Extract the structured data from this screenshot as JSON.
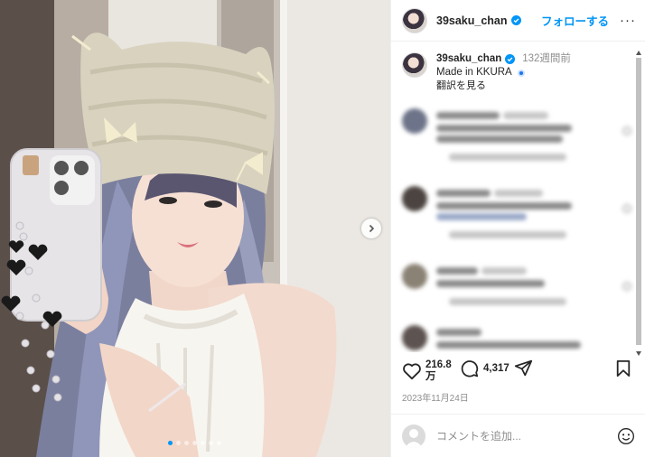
{
  "post": {
    "username": "39saku_chan",
    "follow_label": "フォローする",
    "more_label": "···",
    "caption": {
      "username": "39saku_chan",
      "time_ago": "132週間前",
      "text": "Made in KKURA",
      "translate_label": "翻訳を見る"
    },
    "likes_count": "216.8",
    "likes_unit": "万",
    "comments_count": "4,317",
    "date": "2023年11月24日",
    "carousel_dots": 7,
    "carousel_active_index": 0
  },
  "comment_box": {
    "placeholder": "コメントを追加..."
  },
  "colors": {
    "accent": "#0095f6",
    "text": "#262626",
    "muted": "#8e8e8e"
  },
  "icons": [
    "verified-badge-icon",
    "more-icon",
    "chevron-right-icon",
    "heart-icon",
    "comment-icon",
    "share-icon",
    "bookmark-icon",
    "emoji-icon",
    "user-placeholder-icon"
  ]
}
